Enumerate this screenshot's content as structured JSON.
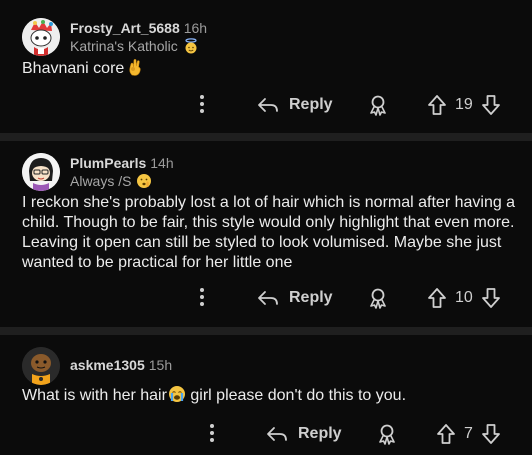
{
  "comments": [
    {
      "username": "Frosty_Art_5688",
      "time": "16h",
      "flair": "Katrina's Katholic",
      "flair_emoji": "angel-emoji-icon",
      "body": "Bhavnani core",
      "body_emoji": "ok-hand-emoji",
      "reply_label": "Reply",
      "score": "19"
    },
    {
      "username": "PlumPearls",
      "time": "14h",
      "flair": "Always /S",
      "flair_emoji": "shushing-face-emoji",
      "body": "I reckon she's probably lost a lot of hair which is normal after having a child. Though to be fair, this style would only highlight that even more. Leaving it open can still be styled to look volumised. Maybe she just wanted to be practical for her little one",
      "reply_label": "Reply",
      "score": "10"
    },
    {
      "username": "askme1305",
      "time": "15h",
      "body_before": "What is with her hair",
      "body_emoji": "crying-face-emoji",
      "body_after": " girl please don't do this to you.",
      "reply_label": "Reply",
      "score": "7"
    }
  ],
  "colors": {
    "background": "#0b0b0b",
    "divider": "#1f1f1f",
    "text": "#ececec",
    "muted": "#9b9b9b"
  }
}
